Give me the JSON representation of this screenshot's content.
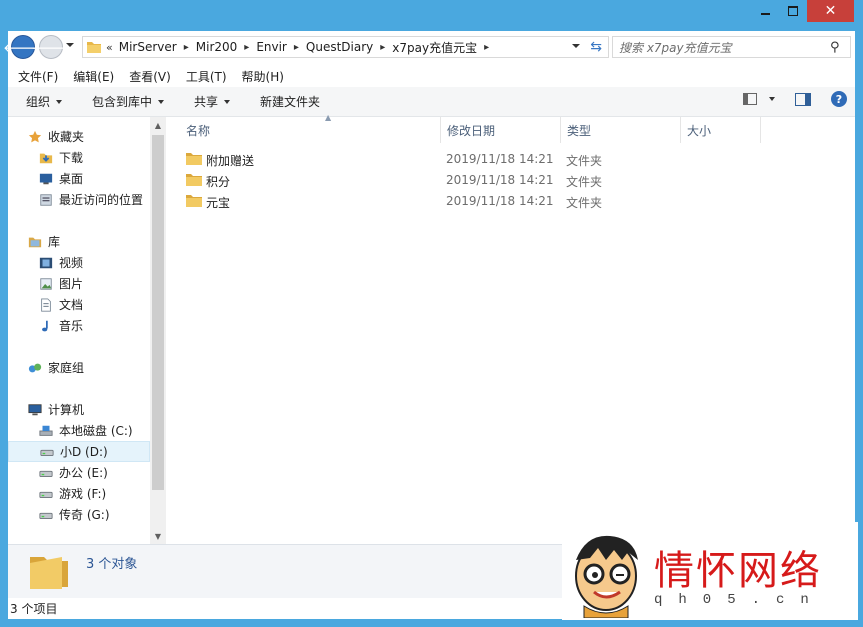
{
  "address": {
    "breadcrumbs": [
      "MirServer",
      "Mir200",
      "Envir",
      "QuestDiary",
      "x7pay充值元宝"
    ]
  },
  "search": {
    "placeholder": "搜索 x7pay充值元宝"
  },
  "menu": [
    "文件(F)",
    "编辑(E)",
    "查看(V)",
    "工具(T)",
    "帮助(H)"
  ],
  "toolbar": {
    "organize": "组织",
    "include_library": "包含到库中",
    "share": "共享",
    "new_folder": "新建文件夹"
  },
  "nav": {
    "favorites": {
      "label": "收藏夹",
      "items": [
        "下载",
        "桌面",
        "最近访问的位置"
      ]
    },
    "libraries": {
      "label": "库",
      "items": [
        "视频",
        "图片",
        "文档",
        "音乐"
      ]
    },
    "homegroup": "家庭组",
    "computer": {
      "label": "计算机",
      "items": [
        "本地磁盘 (C:)",
        "小D (D:)",
        "办公 (E:)",
        "游戏 (F:)",
        "传奇 (G:)"
      ],
      "selected_index": 1
    }
  },
  "columns": [
    "名称",
    "修改日期",
    "类型",
    "大小"
  ],
  "files": [
    {
      "name": "附加赠送",
      "date": "2019/11/18 14:21",
      "type": "文件夹",
      "size": ""
    },
    {
      "name": "积分",
      "date": "2019/11/18 14:21",
      "type": "文件夹",
      "size": ""
    },
    {
      "name": "元宝",
      "date": "2019/11/18 14:21",
      "type": "文件夹",
      "size": ""
    }
  ],
  "details": {
    "count": "3 个对象"
  },
  "status": {
    "items": "3 个项目"
  },
  "watermark": {
    "brand": "情怀网络",
    "url": "qh05.cn"
  },
  "colors": {
    "titlebar": "#4aa8df",
    "close": "#c7403a",
    "folder": "#e8b84a",
    "watermark": "#d61a1a"
  }
}
